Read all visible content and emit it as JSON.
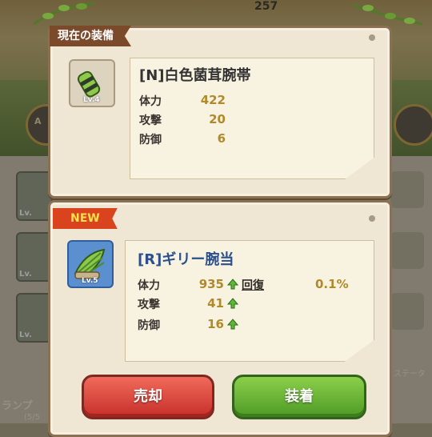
{
  "background": {
    "top_number": "257",
    "left_label": "ランプ",
    "left_sub": "(5/5",
    "right_label": "ステータ",
    "circle_text": "A",
    "slot_lv": "Lv."
  },
  "current": {
    "header": "現在の装備",
    "item_name": "[N]白色菌茸腕帯",
    "icon_level": "Lv.4",
    "stats": [
      {
        "label": "体力",
        "value": "422"
      },
      {
        "label": "攻撃",
        "value": "20"
      },
      {
        "label": "防御",
        "value": "6"
      }
    ]
  },
  "new_item": {
    "badge": "NEW",
    "item_name": "[R]ギリー腕当",
    "icon_level": "Lv.5",
    "stats": [
      {
        "label": "体力",
        "value": "935"
      },
      {
        "label": "攻撃",
        "value": "41"
      },
      {
        "label": "防御",
        "value": "16"
      }
    ],
    "extra_label": "回復",
    "extra_value": "0.1%"
  },
  "buttons": {
    "sell": "売却",
    "equip": "装着"
  },
  "colors": {
    "sell": "#d23a30",
    "equip": "#5aa52e",
    "rare_name": "#2b4f8f",
    "stat_value": "#b08a2a",
    "new_badge": "#d9441e"
  }
}
